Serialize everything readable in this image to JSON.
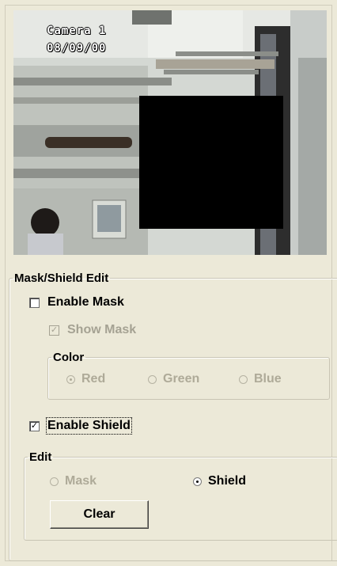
{
  "preview": {
    "camera_label": "Camera 1",
    "date_label": "08/09/00"
  },
  "mask_shield_group": {
    "title": "Mask/Shield Edit"
  },
  "enable_mask": {
    "label": "Enable Mask",
    "checked": false
  },
  "show_mask": {
    "label": "Show Mask",
    "checked": true,
    "disabled": true
  },
  "color_group": {
    "title": "Color",
    "options": [
      {
        "label": "Red",
        "selected": true,
        "disabled": true
      },
      {
        "label": "Green",
        "selected": false,
        "disabled": true
      },
      {
        "label": "Blue",
        "selected": false,
        "disabled": true
      }
    ]
  },
  "enable_shield": {
    "label": "Enable Shield",
    "checked": true
  },
  "edit_group": {
    "title": "Edit",
    "options": [
      {
        "label": "Mask",
        "selected": false,
        "disabled": true
      },
      {
        "label": "Shield",
        "selected": true,
        "disabled": false
      }
    ]
  },
  "clear_button": {
    "label": "Clear"
  },
  "icons": {
    "checkmark": "✓"
  }
}
